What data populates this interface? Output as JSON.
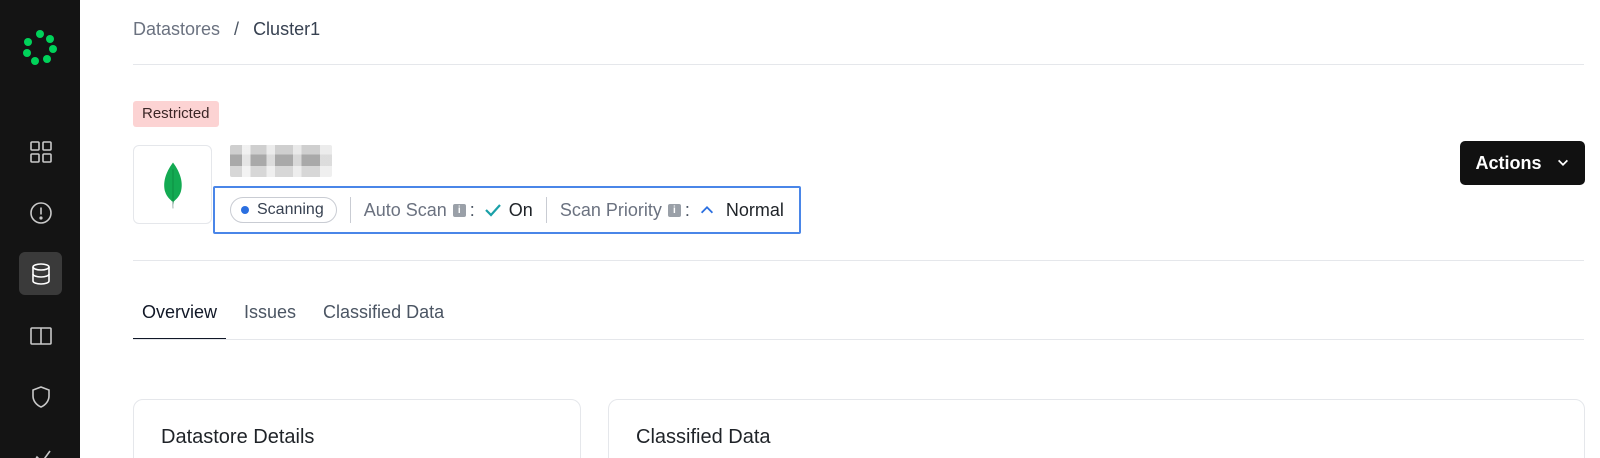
{
  "sidebar": {
    "logo_icon": "company-logo-icon",
    "items": [
      {
        "icon": "dashboard-grid-icon",
        "label": ""
      },
      {
        "icon": "alert-circle-icon",
        "label": ""
      },
      {
        "icon": "database-icon",
        "label": "",
        "active": true
      },
      {
        "icon": "book-icon",
        "label": ""
      },
      {
        "icon": "shield-icon",
        "label": ""
      },
      {
        "icon": "chart-icon",
        "label": ""
      }
    ]
  },
  "breadcrumb": {
    "parent": "Datastores",
    "separator": "/",
    "current": "Cluster1"
  },
  "datastore": {
    "badge": "Restricted",
    "logo_icon": "mongodb-leaf-icon",
    "status_pill": "Scanning",
    "auto_scan_label": "Auto Scan",
    "auto_scan_value": "On",
    "scan_priority_label": "Scan Priority",
    "scan_priority_value": "Normal",
    "colon": ":",
    "info_glyph": "i"
  },
  "actions": {
    "label": "Actions"
  },
  "tabs": [
    {
      "label": "Overview",
      "active": true
    },
    {
      "label": "Issues",
      "active": false
    },
    {
      "label": "Classified Data",
      "active": false
    }
  ],
  "cards": [
    {
      "title": "Datastore Details"
    },
    {
      "title": "Classified Data"
    }
  ],
  "colors": {
    "sidebar_bg": "#141414",
    "brand_green": "#00d35a",
    "highlight_blue": "#4a86e8",
    "restricted_bg": "#fcd3d3",
    "mongo_green": "#13aa52"
  }
}
